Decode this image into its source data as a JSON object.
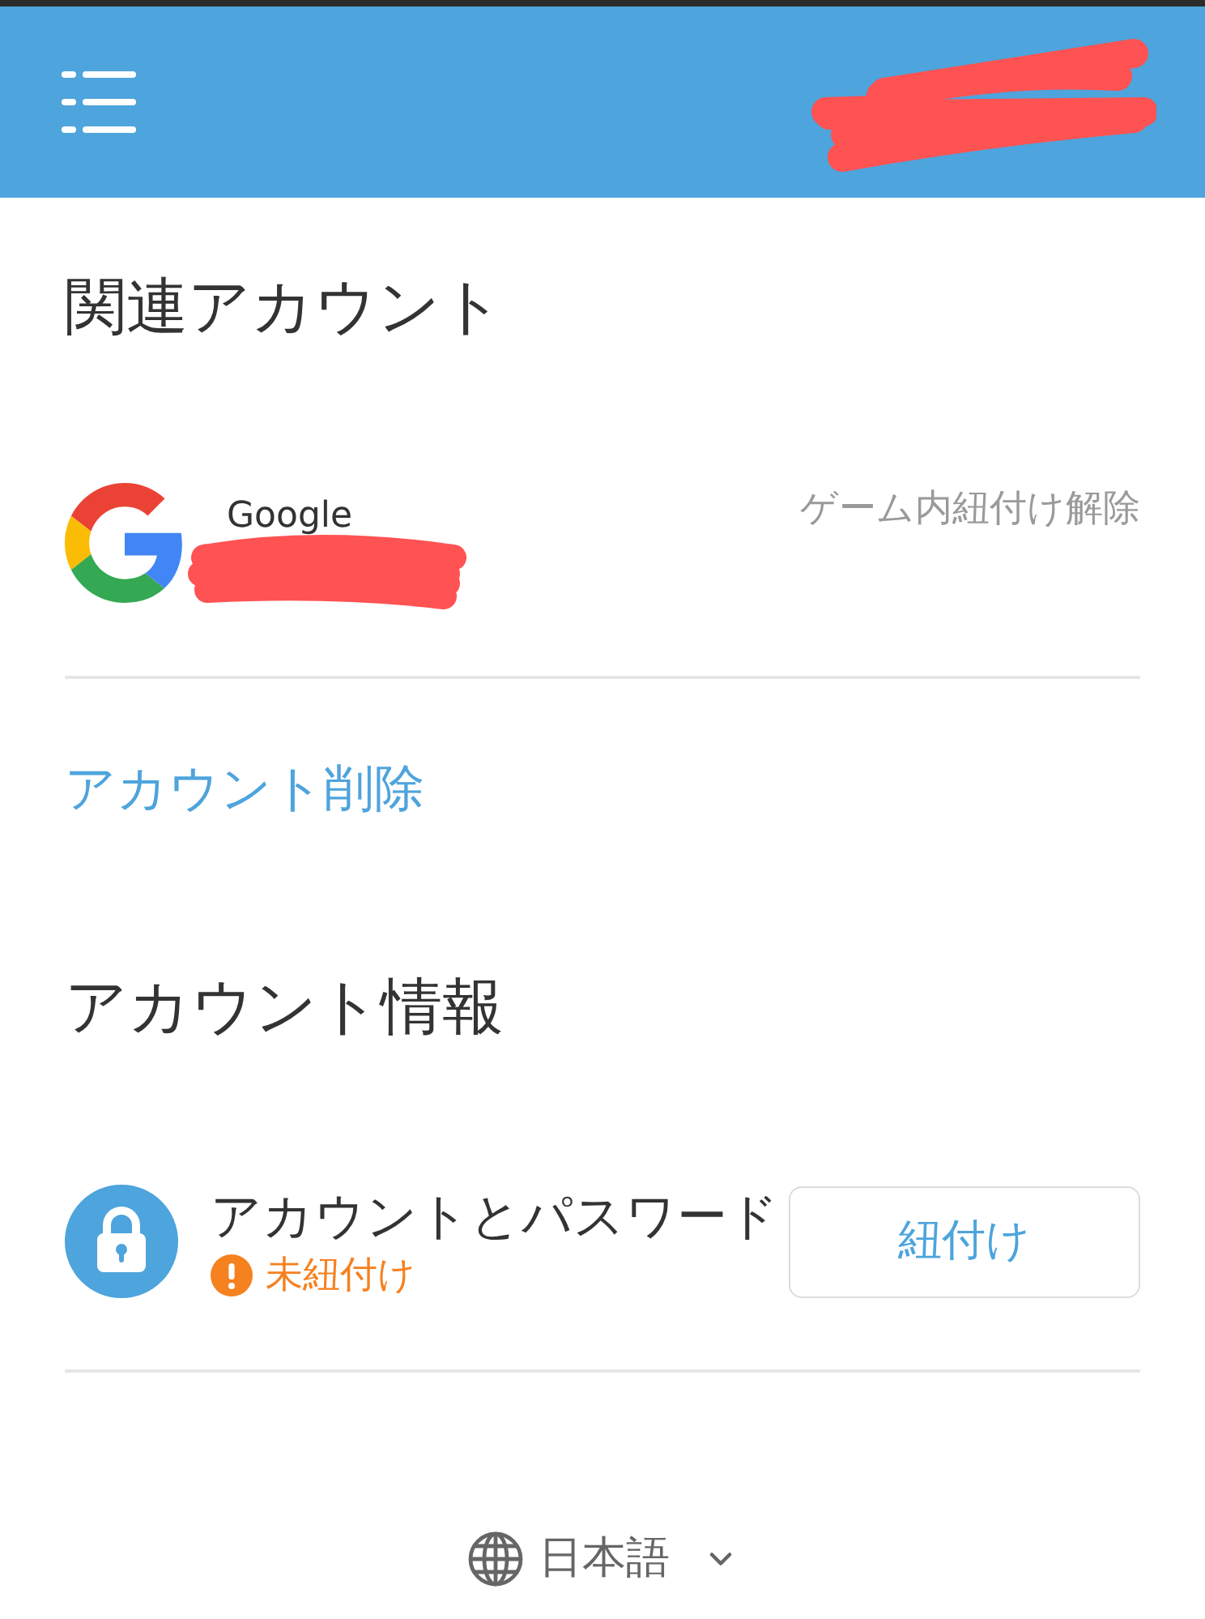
{
  "sections": [
    {
      "kind": "linked",
      "title": "関連アカウント",
      "accounts": [
        {
          "provider": "Google",
          "action": "ゲーム内紐付け解除"
        }
      ],
      "link": "アカウント削除"
    },
    {
      "kind": "info",
      "title": "アカウント情報",
      "items": [
        {
          "label": "アカウントとパスワード",
          "linked": false,
          "status": "未紐付け",
          "button": "紐付け"
        }
      ]
    }
  ],
  "language": {
    "label": "日本語"
  }
}
